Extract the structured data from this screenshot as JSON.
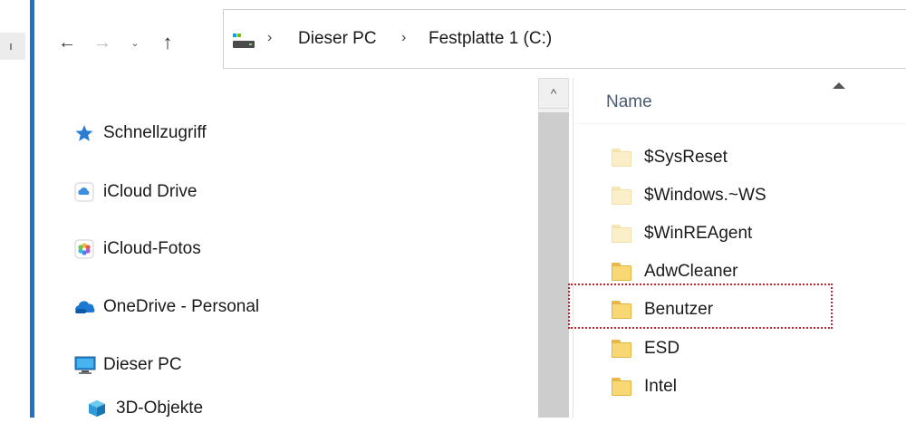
{
  "toolbar": {
    "back_icon": "arrow-left-icon",
    "forward_icon": "arrow-right-icon",
    "recent_icon": "chevron-down-icon",
    "up_icon": "arrow-up-icon",
    "back_glyph": "←",
    "forward_glyph": "→",
    "recent_glyph": "⌄",
    "up_glyph": "↑"
  },
  "address_bar": {
    "icon": "drive-icon",
    "separator": "›",
    "crumbs": [
      "Dieser PC",
      "Festplatte 1 (C:)"
    ]
  },
  "nav_pane": {
    "items": [
      {
        "label": "Schnellzugriff",
        "icon": "star-icon"
      },
      {
        "label": "iCloud Drive",
        "icon": "icloud-drive-icon"
      },
      {
        "label": "iCloud-Fotos",
        "icon": "icloud-photos-icon"
      },
      {
        "label": "OneDrive - Personal",
        "icon": "onedrive-icon"
      },
      {
        "label": "Dieser PC",
        "icon": "monitor-icon"
      },
      {
        "label": "3D-Objekte",
        "icon": "cube-icon"
      }
    ]
  },
  "scrollbar": {
    "up_glyph": "^"
  },
  "file_list": {
    "column_header": "Name",
    "sort": "ascending",
    "rows": [
      {
        "name": "$SysReset",
        "hidden": true
      },
      {
        "name": "$Windows.~WS",
        "hidden": true
      },
      {
        "name": "$WinREAgent",
        "hidden": true
      },
      {
        "name": "AdwCleaner",
        "hidden": false
      },
      {
        "name": "Benutzer",
        "hidden": false,
        "focused": true
      },
      {
        "name": "ESD",
        "hidden": false
      },
      {
        "name": "Intel",
        "hidden": false
      }
    ]
  },
  "colors": {
    "accent": "#1e73c9",
    "folder": "#f8d775",
    "focus_outline": "#c0262d"
  }
}
